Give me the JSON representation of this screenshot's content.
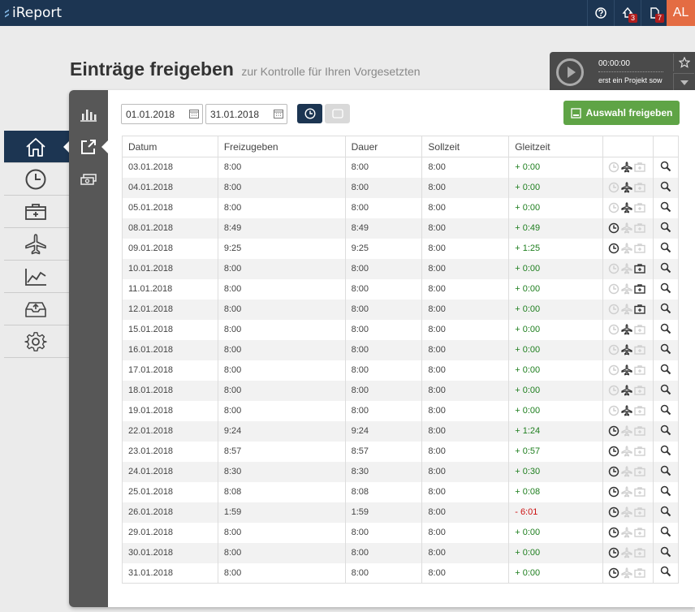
{
  "app": {
    "name": "iReport"
  },
  "header": {
    "notifications_count": "3",
    "documents_count": "7",
    "user_initials": "AL"
  },
  "page": {
    "title": "Einträge freigeben",
    "subtitle": "zur Kontrolle für Ihren Vorgesetzten"
  },
  "timer": {
    "time": "00:00:00",
    "project_hint": "erst ein Projekt sow"
  },
  "filters": {
    "date_from": "01.01.2018",
    "date_to": "31.01.2018"
  },
  "actions": {
    "release_label": "Auswahl freigeben"
  },
  "table": {
    "columns": [
      "Datum",
      "Freizugeben",
      "Dauer",
      "Sollzeit",
      "Gleitzeit"
    ],
    "rows": [
      {
        "date": "03.01.2018",
        "release": "8:00",
        "duration": "8:00",
        "target": "8:00",
        "flex": "+ 0:00",
        "sign": "pos",
        "icons": [
          "clock-off",
          "plane-on",
          "case-off"
        ]
      },
      {
        "date": "04.01.2018",
        "release": "8:00",
        "duration": "8:00",
        "target": "8:00",
        "flex": "+ 0:00",
        "sign": "pos",
        "icons": [
          "clock-off",
          "plane-on",
          "case-off"
        ]
      },
      {
        "date": "05.01.2018",
        "release": "8:00",
        "duration": "8:00",
        "target": "8:00",
        "flex": "+ 0:00",
        "sign": "pos",
        "icons": [
          "clock-off",
          "plane-on",
          "case-off"
        ]
      },
      {
        "date": "08.01.2018",
        "release": "8:49",
        "duration": "8:49",
        "target": "8:00",
        "flex": "+ 0:49",
        "sign": "pos",
        "icons": [
          "clock-on",
          "plane-off",
          "case-off"
        ]
      },
      {
        "date": "09.01.2018",
        "release": "9:25",
        "duration": "9:25",
        "target": "8:00",
        "flex": "+ 1:25",
        "sign": "pos",
        "icons": [
          "clock-on",
          "plane-off",
          "case-off"
        ]
      },
      {
        "date": "10.01.2018",
        "release": "8:00",
        "duration": "8:00",
        "target": "8:00",
        "flex": "+ 0:00",
        "sign": "pos",
        "icons": [
          "clock-off",
          "plane-off",
          "case-on"
        ]
      },
      {
        "date": "11.01.2018",
        "release": "8:00",
        "duration": "8:00",
        "target": "8:00",
        "flex": "+ 0:00",
        "sign": "pos",
        "icons": [
          "clock-off",
          "plane-off",
          "case-on"
        ]
      },
      {
        "date": "12.01.2018",
        "release": "8:00",
        "duration": "8:00",
        "target": "8:00",
        "flex": "+ 0:00",
        "sign": "pos",
        "icons": [
          "clock-off",
          "plane-off",
          "case-on"
        ]
      },
      {
        "date": "15.01.2018",
        "release": "8:00",
        "duration": "8:00",
        "target": "8:00",
        "flex": "+ 0:00",
        "sign": "pos",
        "icons": [
          "clock-off",
          "plane-on",
          "case-off"
        ]
      },
      {
        "date": "16.01.2018",
        "release": "8:00",
        "duration": "8:00",
        "target": "8:00",
        "flex": "+ 0:00",
        "sign": "pos",
        "icons": [
          "clock-off",
          "plane-on",
          "case-off"
        ]
      },
      {
        "date": "17.01.2018",
        "release": "8:00",
        "duration": "8:00",
        "target": "8:00",
        "flex": "+ 0:00",
        "sign": "pos",
        "icons": [
          "clock-off",
          "plane-on",
          "case-off"
        ]
      },
      {
        "date": "18.01.2018",
        "release": "8:00",
        "duration": "8:00",
        "target": "8:00",
        "flex": "+ 0:00",
        "sign": "pos",
        "icons": [
          "clock-off",
          "plane-on",
          "case-off"
        ]
      },
      {
        "date": "19.01.2018",
        "release": "8:00",
        "duration": "8:00",
        "target": "8:00",
        "flex": "+ 0:00",
        "sign": "pos",
        "icons": [
          "clock-off",
          "plane-on",
          "case-off"
        ]
      },
      {
        "date": "22.01.2018",
        "release": "9:24",
        "duration": "9:24",
        "target": "8:00",
        "flex": "+ 1:24",
        "sign": "pos",
        "icons": [
          "clock-on",
          "plane-off",
          "case-off"
        ]
      },
      {
        "date": "23.01.2018",
        "release": "8:57",
        "duration": "8:57",
        "target": "8:00",
        "flex": "+ 0:57",
        "sign": "pos",
        "icons": [
          "clock-on",
          "plane-off",
          "case-off"
        ]
      },
      {
        "date": "24.01.2018",
        "release": "8:30",
        "duration": "8:30",
        "target": "8:00",
        "flex": "+ 0:30",
        "sign": "pos",
        "icons": [
          "clock-on",
          "plane-off",
          "case-off"
        ]
      },
      {
        "date": "25.01.2018",
        "release": "8:08",
        "duration": "8:08",
        "target": "8:00",
        "flex": "+ 0:08",
        "sign": "pos",
        "icons": [
          "clock-on",
          "plane-off",
          "case-off"
        ]
      },
      {
        "date": "26.01.2018",
        "release": "1:59",
        "duration": "1:59",
        "target": "8:00",
        "flex": "- 6:01",
        "sign": "neg",
        "icons": [
          "clock-on",
          "plane-off",
          "case-off"
        ]
      },
      {
        "date": "29.01.2018",
        "release": "8:00",
        "duration": "8:00",
        "target": "8:00",
        "flex": "+ 0:00",
        "sign": "pos",
        "icons": [
          "clock-on",
          "plane-off",
          "case-off"
        ]
      },
      {
        "date": "30.01.2018",
        "release": "8:00",
        "duration": "8:00",
        "target": "8:00",
        "flex": "+ 0:00",
        "sign": "pos",
        "icons": [
          "clock-on",
          "plane-off",
          "case-off"
        ]
      },
      {
        "date": "31.01.2018",
        "release": "8:00",
        "duration": "8:00",
        "target": "8:00",
        "flex": "+ 0:00",
        "sign": "pos",
        "icons": [
          "clock-on",
          "plane-off",
          "case-off"
        ]
      }
    ]
  },
  "colors": {
    "navy": "#1c3552",
    "accent_orange": "#e46c43",
    "release_green": "#5fa446",
    "flex_positive": "#1e7e1e",
    "flex_negative": "#cc1111"
  }
}
